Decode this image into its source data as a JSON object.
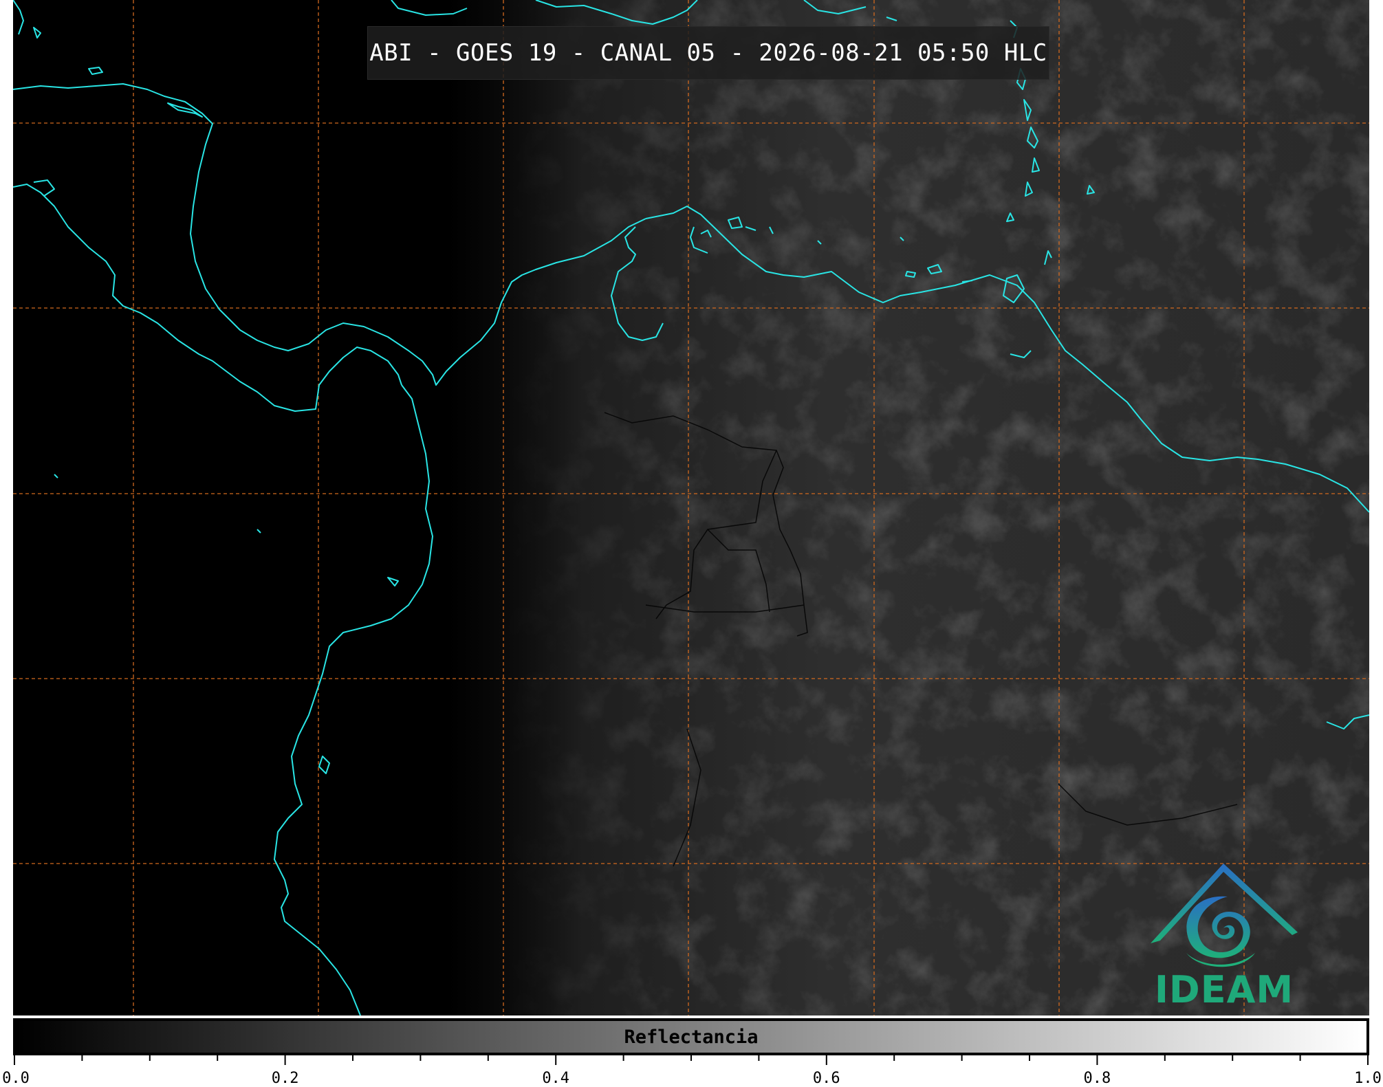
{
  "title": "ABI - GOES 19 - CANAL 05 - 2026-08-21 05:50 HLC",
  "logo": {
    "text": "IDEAM",
    "icon": "ideam-mountain-swirl-logo"
  },
  "colorbar": {
    "label": "Reflectancia",
    "min": 0.0,
    "max": 1.0,
    "ticks": [
      "0.0",
      "0.2",
      "0.4",
      "0.6",
      "0.8",
      "1.0"
    ],
    "minor_ticks_between": 4
  },
  "colors": {
    "coastline": "#29e5e5",
    "grid": "#d2691e",
    "background": "#000000",
    "logo_blue": "#2a7bbf",
    "logo_green": "#1fa97a"
  }
}
